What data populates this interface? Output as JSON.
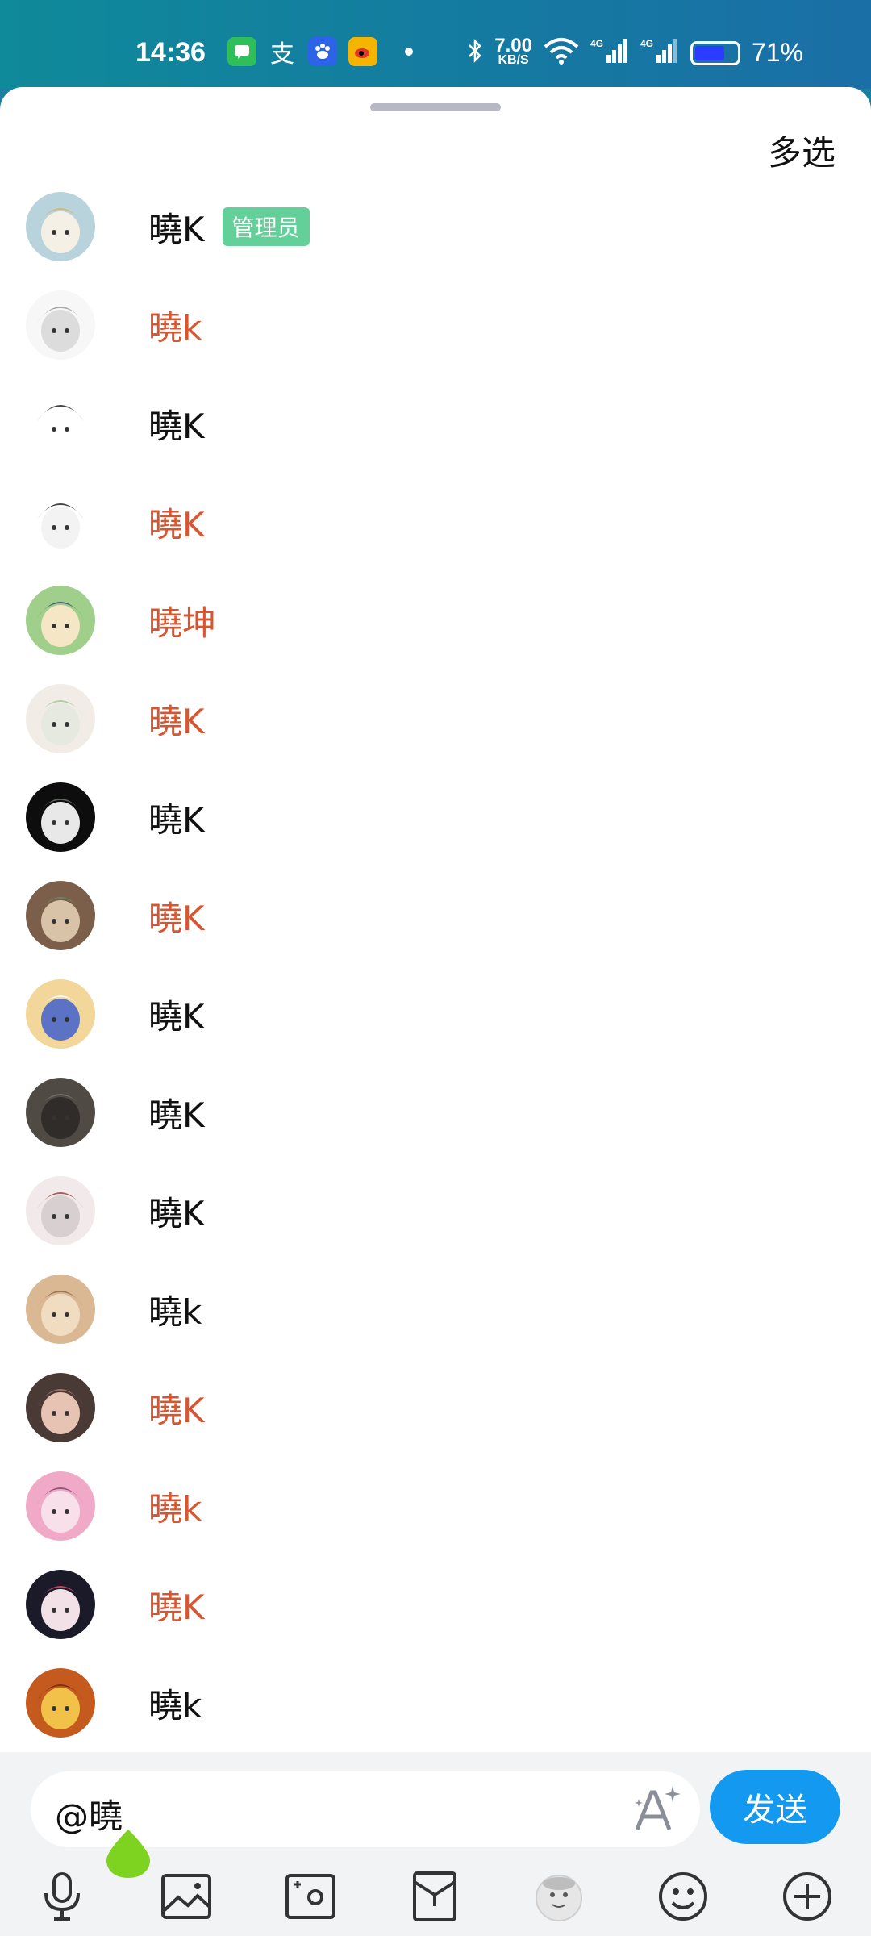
{
  "status_bar": {
    "time": "14:36",
    "net_speed_value": "7.00",
    "net_speed_unit": "KB/S",
    "battery_percent": "71%",
    "battery_level": 0.71,
    "icons": [
      "messages-app-icon",
      "alipay-icon",
      "baidu-icon",
      "weibo-icon",
      "dot-icon",
      "bluetooth-icon",
      "wifi-icon",
      "signal-4g-icon",
      "signal-4g-icon",
      "battery-icon"
    ]
  },
  "sheet": {
    "multi_select_label": "多选"
  },
  "members": [
    {
      "name": "曉K",
      "tag": "管理员",
      "color": "#111111",
      "avatar": "hooded-creature"
    },
    {
      "name": "曉k",
      "tag": "",
      "color": "#d9552f",
      "avatar": "sketch-girl"
    },
    {
      "name": "曉K",
      "tag": "",
      "color": "#111111",
      "avatar": "hello-kitty"
    },
    {
      "name": "曉K",
      "tag": "",
      "color": "#d9552f",
      "avatar": "meme-face"
    },
    {
      "name": "曉坤",
      "tag": "",
      "color": "#d9552f",
      "avatar": "green-hair-girl"
    },
    {
      "name": "曉K",
      "tag": "",
      "color": "#d9552f",
      "avatar": "white-hair-girl"
    },
    {
      "name": "曉K",
      "tag": "",
      "color": "#111111",
      "avatar": "dark-bg-character"
    },
    {
      "name": "曉K",
      "tag": "",
      "color": "#d9552f",
      "avatar": "brown-hair-girl"
    },
    {
      "name": "曉K",
      "tag": "",
      "color": "#111111",
      "avatar": "blonde-character"
    },
    {
      "name": "曉K",
      "tag": "",
      "color": "#111111",
      "avatar": "photo-person"
    },
    {
      "name": "曉K",
      "tag": "",
      "color": "#111111",
      "avatar": "silver-hair-girl"
    },
    {
      "name": "曉k",
      "tag": "",
      "color": "#111111",
      "avatar": "fox-girl"
    },
    {
      "name": "曉K",
      "tag": "",
      "color": "#d9552f",
      "avatar": "dark-hair-girl"
    },
    {
      "name": "曉k",
      "tag": "",
      "color": "#d9552f",
      "avatar": "pink-hair-girl"
    },
    {
      "name": "曉K",
      "tag": "",
      "color": "#d9552f",
      "avatar": "black-hair-girl"
    },
    {
      "name": "曉k",
      "tag": "",
      "color": "#111111",
      "avatar": "autumn-character"
    }
  ],
  "input": {
    "value": "@曉",
    "send_label": "发送"
  },
  "toolbar": {
    "items": [
      "microphone-icon",
      "image-icon",
      "camera-icon",
      "red-packet-icon",
      "sticker-icon",
      "emoji-icon",
      "plus-icon"
    ]
  },
  "colors": {
    "accent": "#1499f0",
    "admin_tag": "#63d09a",
    "highlight_name": "#d9552f"
  }
}
